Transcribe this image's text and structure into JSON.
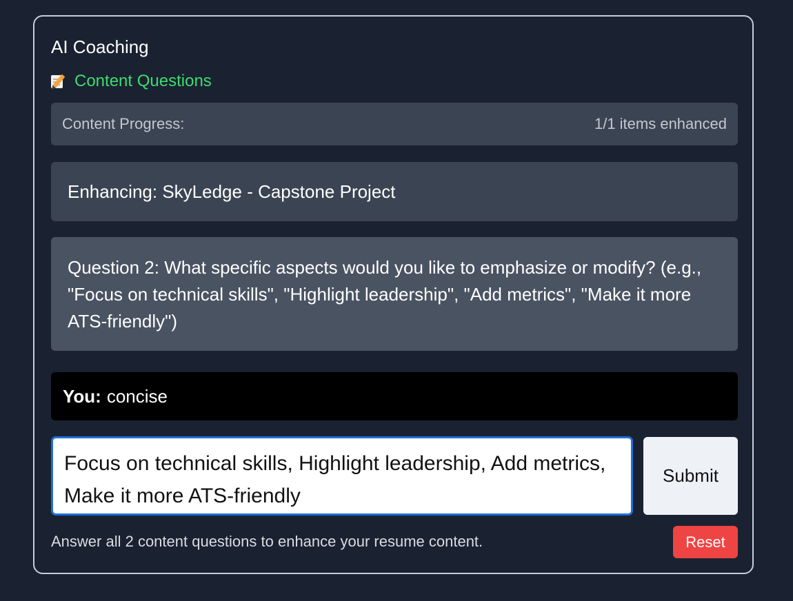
{
  "panel": {
    "title": "AI Coaching",
    "section_label": "Content Questions",
    "section_icon": "memo-icon"
  },
  "progress": {
    "label": "Content Progress:",
    "status": "1/1 items enhanced"
  },
  "enhancing": {
    "text": "Enhancing: SkyLedge - Capstone Project"
  },
  "question": {
    "text": "Question 2: What specific aspects would you like to emphasize or modify? (e.g., \"Focus on technical skills\", \"Highlight leadership\", \"Add metrics\", \"Make it more ATS-friendly\")"
  },
  "answer": {
    "speaker": "You:",
    "text": "concise"
  },
  "input": {
    "value": "Focus on technical skills, Highlight leadership, Add metrics, Make it more ATS-friendly"
  },
  "actions": {
    "submit_label": "Submit",
    "reset_label": "Reset"
  },
  "hint": {
    "text": "Answer all 2 content questions to enhance your resume content."
  },
  "colors": {
    "background": "#1a2231",
    "accent_green": "#3ddc6e",
    "input_focus": "#1f6fd6",
    "reset_red": "#ef4444"
  }
}
